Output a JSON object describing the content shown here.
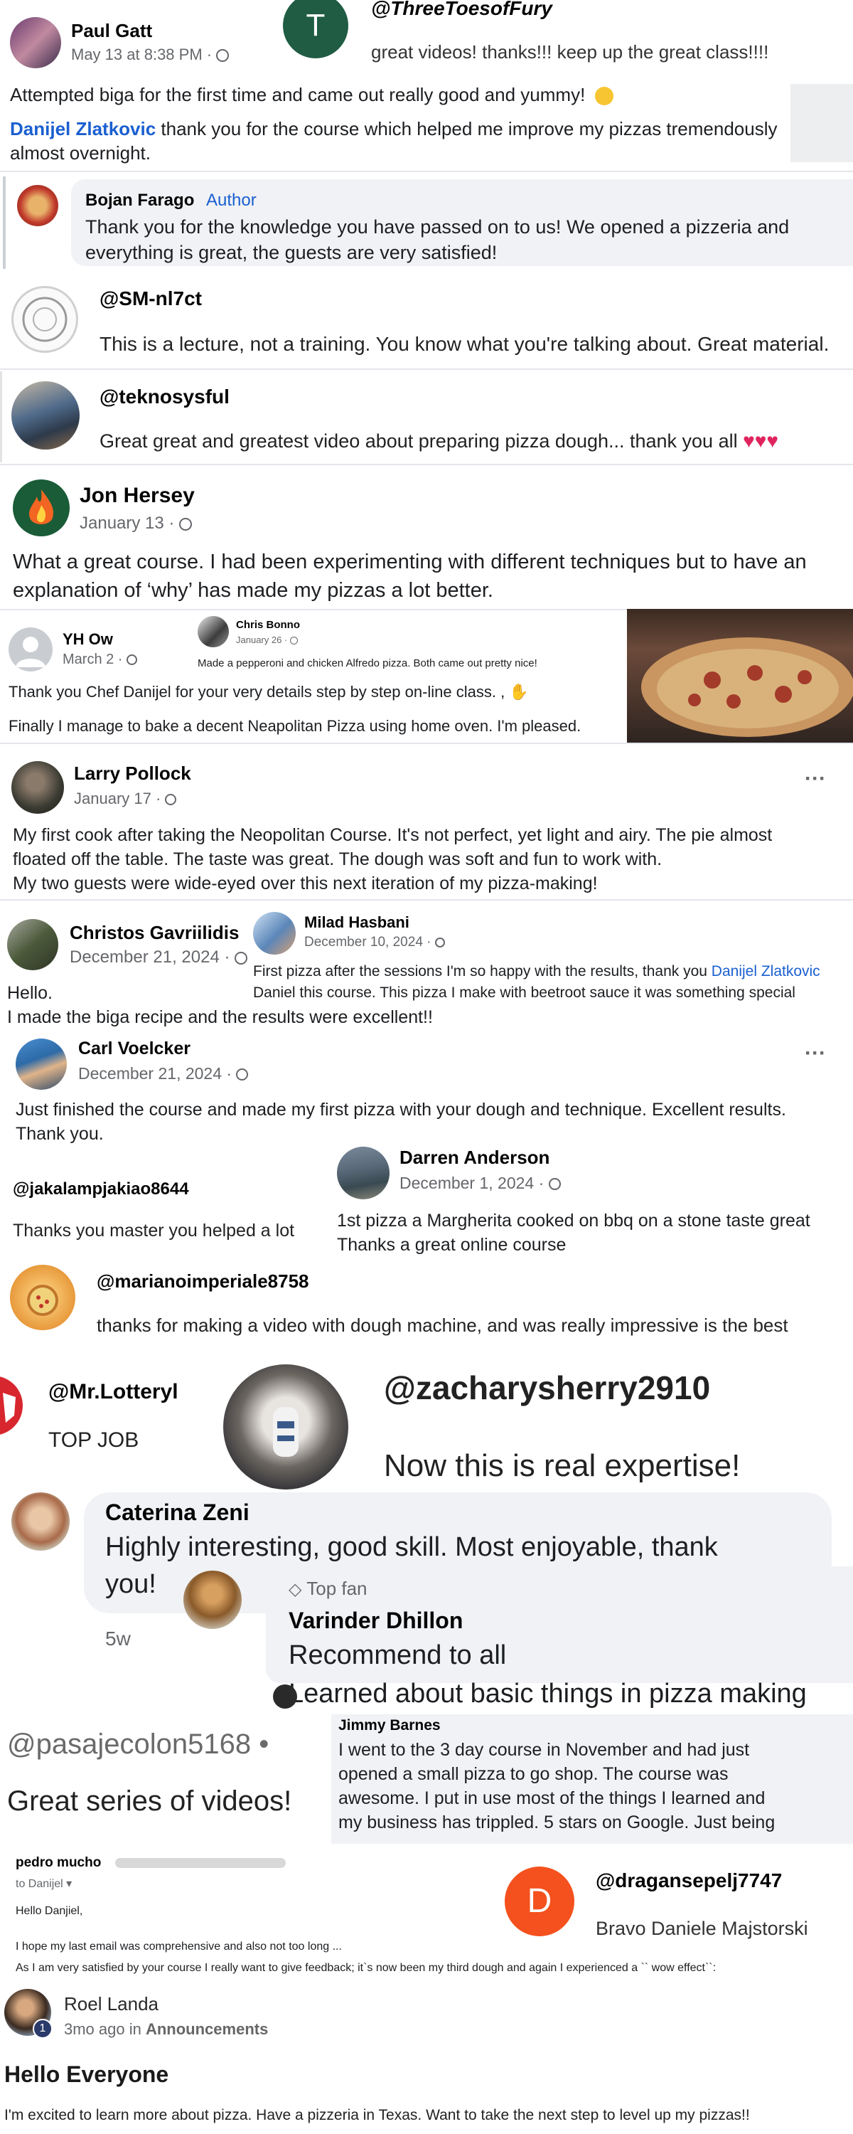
{
  "c1": {
    "name": "Paul Gatt",
    "time": "May 13 at 8:38 PM · ",
    "text": "Attempted biga for the first time and came out really good and yummy!",
    "mention": "Danijel Zlatkovic",
    "text2": " thank you for the course which helped me improve my pizzas tremendously",
    "text3": "almost overnight."
  },
  "c2": {
    "handle": "@ThreeToesofFury",
    "text": "great videos! thanks!!! keep up the great class!!!!",
    "avatar_letter": "T"
  },
  "c3": {
    "name": "Bojan Farago",
    "badge": "Author",
    "line1": "Thank you for the knowledge you have passed on to us! We opened a pizzeria and",
    "line2": "everything is great, the guests are very satisfied!"
  },
  "c4": {
    "handle": "@SM-nl7ct",
    "text": "This is a lecture, not a training. You know what you're talking about. Great material."
  },
  "c5": {
    "handle": "@teknosysful",
    "text": "Great great and greatest video about preparing pizza dough... thank you all "
  },
  "c6": {
    "name": "Jon Hersey",
    "time": "January 13 · ",
    "line1": "What a great course. I had been experimenting with different techniques but to have an",
    "line2": "explanation of ‘why’ has made my pizzas a lot better."
  },
  "c7": {
    "name": "YH Ow",
    "time": "March 2 · ",
    "line1": "Thank you Chef Danijel for your very details step by step on-line class. ,",
    "line2": "Finally I manage to bake a decent Neapolitan Pizza using home oven. I'm pleased."
  },
  "c8": {
    "name": "Chris Bonno",
    "time": "January 26 · ",
    "text": "Made a pepperoni and chicken Alfredo pizza. Both came out pretty nice!"
  },
  "c9": {
    "name": "Larry Pollock",
    "time": "January 17 · ",
    "line1": "My first cook after taking the Neopolitan Course. It's not perfect, yet light and airy. The pie almost",
    "line2": "floated off the table. The taste was great. The dough was soft and fun to work with.",
    "line3": "My two guests were wide-eyed over this next iteration of my pizza-making!",
    "more": "···"
  },
  "c10": {
    "name": "Christos Gavriilidis",
    "time": "December 21, 2024 · ",
    "line1": "Hello.",
    "line2": "I made the biga recipe and the results were excellent!!"
  },
  "c11": {
    "name": "Milad Hasbani",
    "time": "December 10, 2024 · ",
    "line1a": "First pizza after the sessions I'm so happy with the results, thank you ",
    "mention": "Danijel Zlatkovic",
    "line2": "Daniel this course. This pizza I make with beetroot sauce it was something special"
  },
  "c12": {
    "name": "Carl Voelcker",
    "time": "December 21, 2024 · ",
    "line1": "Just finished the course and made my first pizza with your dough and technique. Excellent results.",
    "line2": "Thank you.",
    "more": "···"
  },
  "c13": {
    "handle": "@jakalampjakiao8644",
    "text": "Thanks you master you helped a lot"
  },
  "c14": {
    "name": "Darren Anderson",
    "time": "December 1, 2024 · ",
    "line1": "1st pizza a Margherita cooked on bbq on a stone taste great",
    "line2": "Thanks a great online course"
  },
  "c15": {
    "handle": "@marianoimperiale8758",
    "text": "thanks for making a video with dough machine, and was really impressive is the best"
  },
  "c16": {
    "handle": "@Mr.Lotteryl",
    "text": "TOP JOB"
  },
  "c17": {
    "handle": "@zacharysherry2910",
    "text": "Now this is real expertise!"
  },
  "c18": {
    "name": "Caterina Zeni",
    "line1": "Highly interesting, good skill. Most enjoyable, thank",
    "line2": "you!",
    "time": "5w"
  },
  "c19": {
    "badge": "Top fan",
    "name": "Varinder Dhillon",
    "line1": "Recommend to all",
    "line2": "Learned about basic things in pizza making"
  },
  "c20": {
    "handle": "@pasajecolon5168",
    "dot": " • ",
    "text": "Great series of videos!"
  },
  "c21": {
    "name": "Jimmy Barnes",
    "line1": "I went to the 3 day course in November and had just",
    "line2": "opened a small pizza to go shop. The course was",
    "line3": "awesome. I put in use most of the things I learned and",
    "line4": "my business has trippled. 5 stars on Google. Just being"
  },
  "c22": {
    "name": "pedro mucho",
    "to": "to Danijel",
    "greeting": "Hello Danjiel,",
    "line1": "I hope my last email was comprehensive and also not too long ...",
    "line2": "As I am very satisfied by your course I really want to give feedback; it`s now been my third dough and again I experienced a `` wow effect``:"
  },
  "c23": {
    "handle": "@dragansepelj7747",
    "text": "Bravo Daniele Majstorski",
    "avatar_letter": "D"
  },
  "c24": {
    "name": "Roel Landa",
    "badge_num": "1",
    "time": "3mo ago in ",
    "location": "Announcements",
    "title": "Hello Everyone",
    "text": "I'm excited to learn more about pizza. Have a pizzeria in Texas. Want to take the next step to level up my pizzas!!"
  },
  "colors": {
    "link": "#1a5fd0",
    "meta": "#65676b",
    "bubble": "#f0f2f5",
    "avatar_green": "#1f5c43",
    "avatar_orange": "#f4511e",
    "heart": "#e0245e"
  },
  "icons": [
    "globe-icon",
    "smiley-icon",
    "heart-icon",
    "praying-hands-icon",
    "more-icon",
    "diamond-icon",
    "chevron-down-icon"
  ]
}
